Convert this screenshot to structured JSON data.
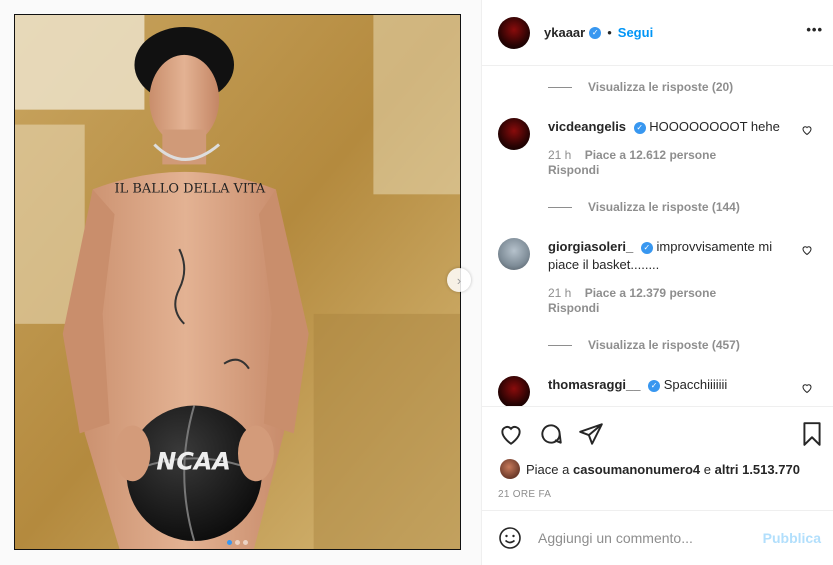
{
  "header": {
    "username": "ykaaar",
    "separator": "•",
    "follow_label": "Segui",
    "more_label": "•••"
  },
  "comments": [
    {
      "type": "replies",
      "label": "Visualizza le risposte (20)"
    },
    {
      "type": "comment",
      "username": "vicdeangelis",
      "verified": true,
      "text": "HOOOOOOOOT hehe",
      "time": "21 h",
      "likes": "Piace a 12.612 persone",
      "reply": "Rispondi",
      "avatar": "red-dark"
    },
    {
      "type": "replies",
      "label": "Visualizza le risposte (144)"
    },
    {
      "type": "comment",
      "username": "giorgiasoleri_",
      "verified": true,
      "text": "improvvisamente mi piace il basket........",
      "time": "21 h",
      "likes": "Piace a 12.379 persone",
      "reply": "Rispondi",
      "avatar": "grey"
    },
    {
      "type": "replies",
      "label": "Visualizza le risposte (457)"
    },
    {
      "type": "comment",
      "username": "thomasraggi__",
      "verified": true,
      "text": "Spacchiiiiiii",
      "avatar": "red-dark"
    }
  ],
  "actions": {
    "icons": [
      "heart-icon",
      "comment-icon",
      "share-icon",
      "bookmark-icon"
    ]
  },
  "likes": {
    "prefix": "Piace a",
    "user": "casoumanonumero4",
    "middle": "e",
    "others": "altri 1.513.770"
  },
  "timestamp": "21 ORE FA",
  "add_comment": {
    "placeholder": "Aggiungi un commento...",
    "publish_label": "Pubblica"
  },
  "colors": {
    "accent": "#0095f6",
    "verified": "#3897f0",
    "muted": "#8e8e8e",
    "publish_disabled": "#b2dffc"
  },
  "photo": {
    "caption_tattoo": "IL BALLO DELLA VITA",
    "ball_text": "NCAA",
    "carousel_count": 3,
    "carousel_active": 1
  }
}
